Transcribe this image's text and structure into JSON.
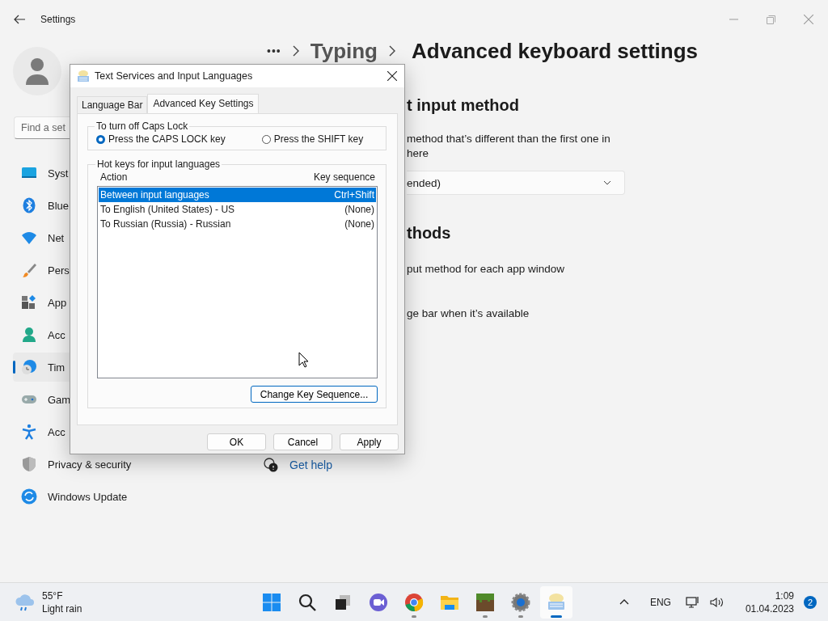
{
  "settings": {
    "title": "Settings",
    "search": {
      "placeholder": "Find a set"
    },
    "nav": [
      {
        "kind": "system",
        "label": "Syst",
        "selected": false
      },
      {
        "kind": "bluetooth",
        "label": "Blue",
        "selected": false
      },
      {
        "kind": "network",
        "label": "Net",
        "selected": false
      },
      {
        "kind": "personalization",
        "label": "Pers",
        "selected": false
      },
      {
        "kind": "apps",
        "label": "App",
        "selected": false
      },
      {
        "kind": "accounts",
        "label": "Acc",
        "selected": false
      },
      {
        "kind": "time",
        "label": "Tim",
        "selected": true
      },
      {
        "kind": "gaming",
        "label": "Gam",
        "selected": false
      },
      {
        "kind": "accessibility",
        "label": "Acc",
        "selected": false
      },
      {
        "kind": "privacy",
        "label": "Privacy & security",
        "selected": false
      },
      {
        "kind": "update",
        "label": "Windows Update",
        "selected": false
      }
    ],
    "breadcrumb": {
      "more": "•••",
      "parent": "Typing",
      "current": "Advanced keyboard settings"
    },
    "sections": [
      {
        "heading": "t input method",
        "description": [
          "method that’s different than the first one in",
          "here"
        ],
        "dropdown": {
          "value": "ended)"
        }
      },
      {
        "heading": "thods",
        "options": [
          "put method for each app window",
          "ge bar when it’s available"
        ]
      }
    ],
    "help_link": "Get help"
  },
  "dialog": {
    "title": "Text Services and Input Languages",
    "tabs": [
      {
        "label": "Language Bar",
        "selected": false
      },
      {
        "label": "Advanced Key Settings",
        "selected": true
      }
    ],
    "caps_group": {
      "title": "To turn off Caps Lock",
      "options": [
        {
          "label": "Press the CAPS LOCK key",
          "selected": true
        },
        {
          "label": "Press the SHIFT key",
          "selected": false
        }
      ]
    },
    "hotkeys_group": {
      "title": "Hot keys for input languages",
      "columns": [
        "Action",
        "Key sequence"
      ],
      "rows": [
        {
          "action": "Between input languages",
          "key_sequence": "Ctrl+Shift",
          "selected": true
        },
        {
          "action": "To English (United States) - US",
          "key_sequence": "(None)",
          "selected": false
        },
        {
          "action": "To Russian (Russia) - Russian",
          "key_sequence": "(None)",
          "selected": false
        }
      ],
      "change_button": "Change Key Sequence..."
    },
    "buttons": [
      "OK",
      "Cancel",
      "Apply"
    ]
  },
  "taskbar": {
    "weather": {
      "temperature": "55°F",
      "condition": "Light rain"
    },
    "apps": [
      {
        "kind": "start",
        "running": false,
        "active": false
      },
      {
        "kind": "search",
        "running": false,
        "active": false
      },
      {
        "kind": "taskview",
        "running": false,
        "active": false
      },
      {
        "kind": "chat",
        "running": false,
        "active": false
      },
      {
        "kind": "browser",
        "running": true,
        "active": false
      },
      {
        "kind": "files",
        "running": false,
        "active": false
      },
      {
        "kind": "game",
        "running": true,
        "active": false
      },
      {
        "kind": "settings",
        "running": true,
        "active": false
      },
      {
        "kind": "keyboard",
        "running": true,
        "active": true
      }
    ],
    "tray": {
      "language": "ENG",
      "time": "1:09",
      "date": "01.04.2023",
      "notifications": "2"
    }
  }
}
